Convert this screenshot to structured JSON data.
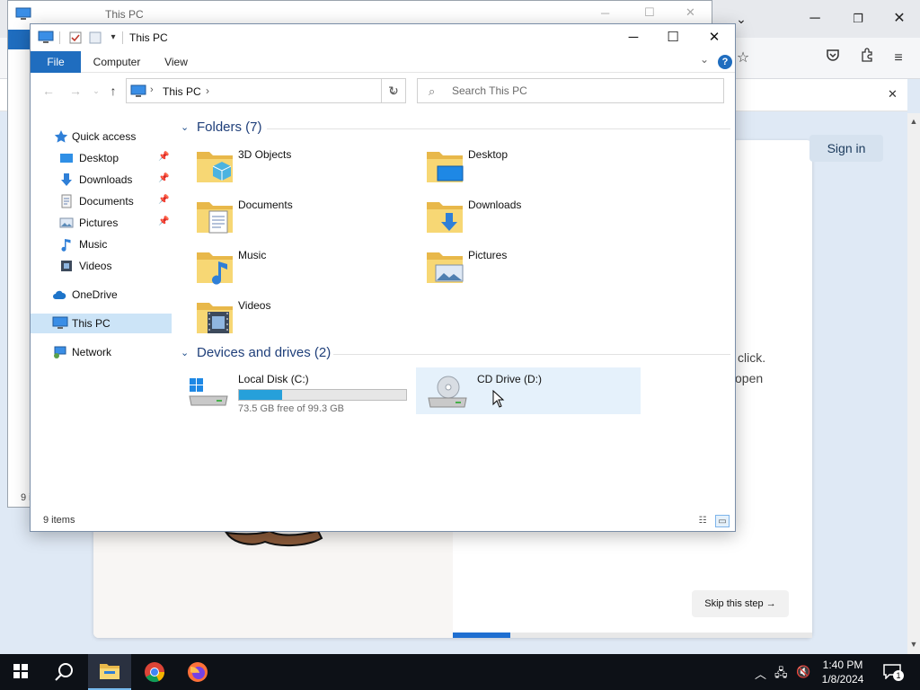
{
  "window": {
    "title": "This PC",
    "controls": {
      "minimize": "─",
      "maximize": "☐",
      "close": "✕"
    }
  },
  "background_window": {
    "title": "This PC",
    "status_text": "9 i"
  },
  "ribbon": {
    "tabs": [
      {
        "label": "File"
      },
      {
        "label": "Computer"
      },
      {
        "label": "View"
      }
    ],
    "help_label": "?"
  },
  "navbar": {
    "breadcrumb": "This PC",
    "search_placeholder": "Search This PC"
  },
  "nav_pane": {
    "items": [
      {
        "label": "Quick access",
        "icon": "star-icon",
        "pinned": false
      },
      {
        "label": "Desktop",
        "icon": "desktop-icon",
        "pinned": true
      },
      {
        "label": "Downloads",
        "icon": "download-icon",
        "pinned": true
      },
      {
        "label": "Documents",
        "icon": "document-icon",
        "pinned": true
      },
      {
        "label": "Pictures",
        "icon": "picture-icon",
        "pinned": true
      },
      {
        "label": "Music",
        "icon": "music-icon",
        "pinned": false
      },
      {
        "label": "Videos",
        "icon": "video-icon",
        "pinned": false
      },
      {
        "label": "OneDrive",
        "icon": "cloud-icon",
        "pinned": false
      },
      {
        "label": "This PC",
        "icon": "computer-icon",
        "pinned": false,
        "selected": true
      },
      {
        "label": "Network",
        "icon": "network-icon",
        "pinned": false
      }
    ]
  },
  "content": {
    "folders_header": "Folders (7)",
    "folders": [
      {
        "name": "3D Objects",
        "icon": "3d-objects-folder-icon"
      },
      {
        "name": "Desktop",
        "icon": "desktop-folder-icon"
      },
      {
        "name": "Documents",
        "icon": "documents-folder-icon"
      },
      {
        "name": "Downloads",
        "icon": "downloads-folder-icon"
      },
      {
        "name": "Music",
        "icon": "music-folder-icon"
      },
      {
        "name": "Pictures",
        "icon": "pictures-folder-icon"
      },
      {
        "name": "Videos",
        "icon": "videos-folder-icon"
      }
    ],
    "drives_header": "Devices and drives (2)",
    "drives": [
      {
        "name": "Local Disk (C:)",
        "free_text": "73.5 GB free of 99.3 GB",
        "used_fraction": 0.26
      },
      {
        "name": "CD Drive (D:)"
      }
    ]
  },
  "status_bar": {
    "item_count": "9 items"
  },
  "browser": {
    "sign_in_label": "Sign in",
    "text_fragment_1": "click.",
    "text_fragment_2": "open",
    "skip_label": "Skip this step →",
    "progress_fraction": 0.16
  },
  "taskbar": {
    "time": "1:40 PM",
    "date": "1/8/2024",
    "notification_count": "1",
    "apps": [
      "windows-start-icon",
      "search-icon",
      "file-explorer-icon",
      "chrome-icon",
      "firefox-icon"
    ]
  },
  "colors": {
    "accent": "#1f6dbf",
    "selection": "#cce4f7",
    "drive_bar": "#26a0da",
    "folder": "#f2c94c"
  }
}
